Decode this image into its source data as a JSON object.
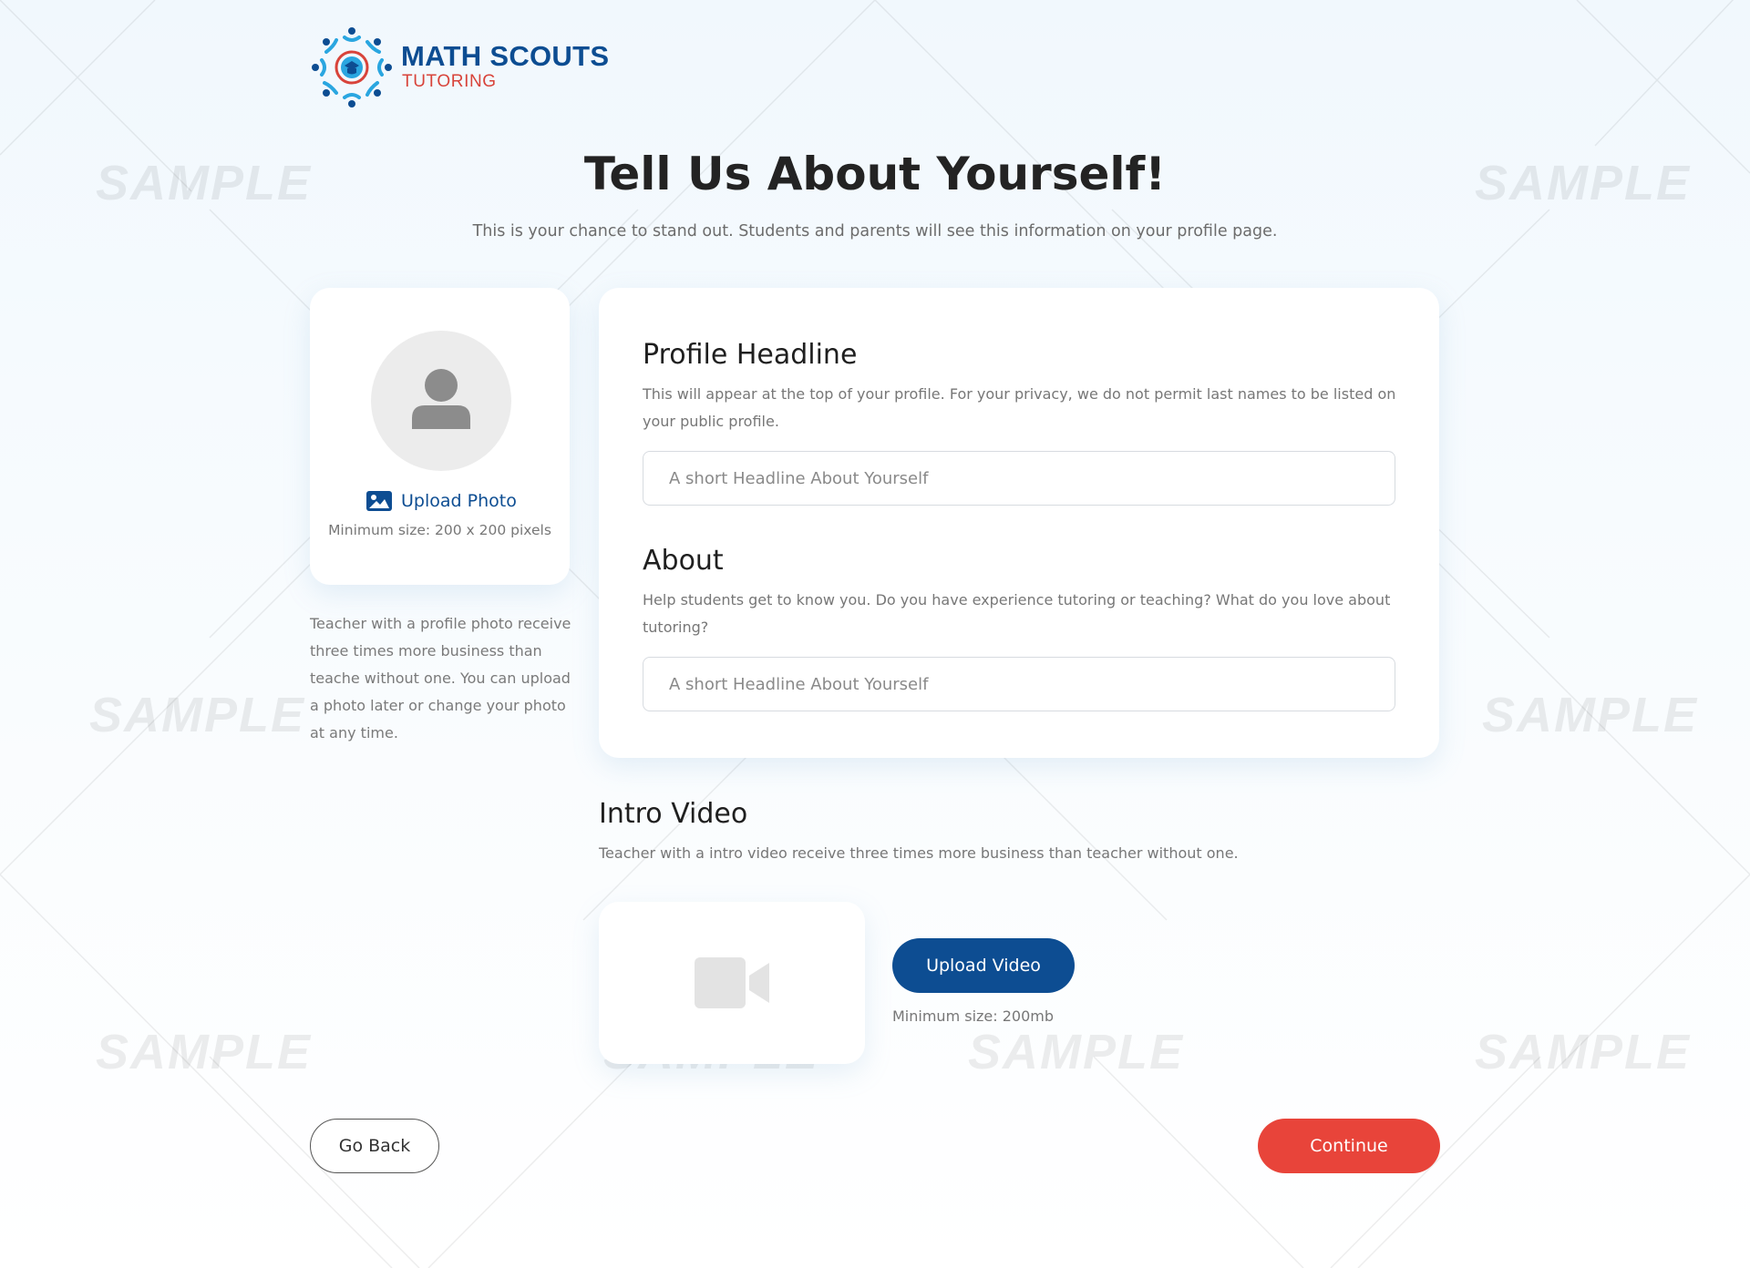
{
  "brand": {
    "name": "MATH SCOUTS",
    "tagline": "TUTORING",
    "logo_icon": "scouts-circle-logo-icon",
    "colors": {
      "primary": "#0d4d92",
      "accent": "#d8433a",
      "light_blue": "#2aa6e0"
    }
  },
  "watermark": {
    "text": "SAMPLE"
  },
  "header": {
    "title": "Tell Us About Yourself!",
    "subtitle": "This is your chance to stand out. Students and parents will see this information on your profile page."
  },
  "photo": {
    "avatar_icon": "user-avatar-icon",
    "upload_icon": "image-icon",
    "upload_label": "Upload Photo",
    "min_size": "Minimum size: 200 x 200 pixels",
    "note": "Teacher with a profile photo receive three times more business than teache without one. You can upload a photo later or change your photo at any time."
  },
  "profile_headline": {
    "title": "Profile Headline",
    "description": "This will appear at the top of your profile. For your privacy, we do not permit last names to be listed on your public profile.",
    "placeholder": "A short Headline About Yourself",
    "value": ""
  },
  "about": {
    "title": "About",
    "description": "Help students get to know you. Do you have experience tutoring or teaching? What do you love about tutoring?",
    "placeholder": "A short Headline About Yourself",
    "value": ""
  },
  "intro_video": {
    "title": "Intro Video",
    "description": "Teacher with a intro video receive three times more business than teacher without one.",
    "video_icon": "video-camera-icon",
    "upload_label": "Upload Video",
    "min_size": "Minimum size: 200mb"
  },
  "footer": {
    "back_label": "Go Back",
    "continue_label": "Continue",
    "colors": {
      "continue": "#e8443a"
    }
  }
}
